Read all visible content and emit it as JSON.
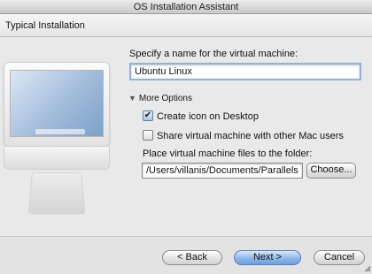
{
  "window": {
    "title": "OS Installation Assistant"
  },
  "header": {
    "title": "Typical Installation"
  },
  "form": {
    "name_label": "Specify a name for the virtual machine:",
    "name_value": "Ubuntu Linux",
    "more_options_label": "More Options",
    "create_icon_label": "Create icon on Desktop",
    "create_icon_checked": true,
    "share_vm_label": "Share virtual machine with other Mac users",
    "share_vm_checked": false,
    "folder_label": "Place virtual machine files to the folder:",
    "folder_value": "/Users/villanis/Documents/Parallels",
    "choose_label": "Choose..."
  },
  "footer": {
    "back_label": "< Back",
    "next_label": "Next >",
    "cancel_label": "Cancel"
  },
  "icons": {
    "disclosure": "disclosure-triangle-down-icon",
    "checkmark": "checkmark-icon"
  },
  "colors": {
    "focus_ring": "#8fb1dd",
    "default_button": "#6c9fe0"
  }
}
